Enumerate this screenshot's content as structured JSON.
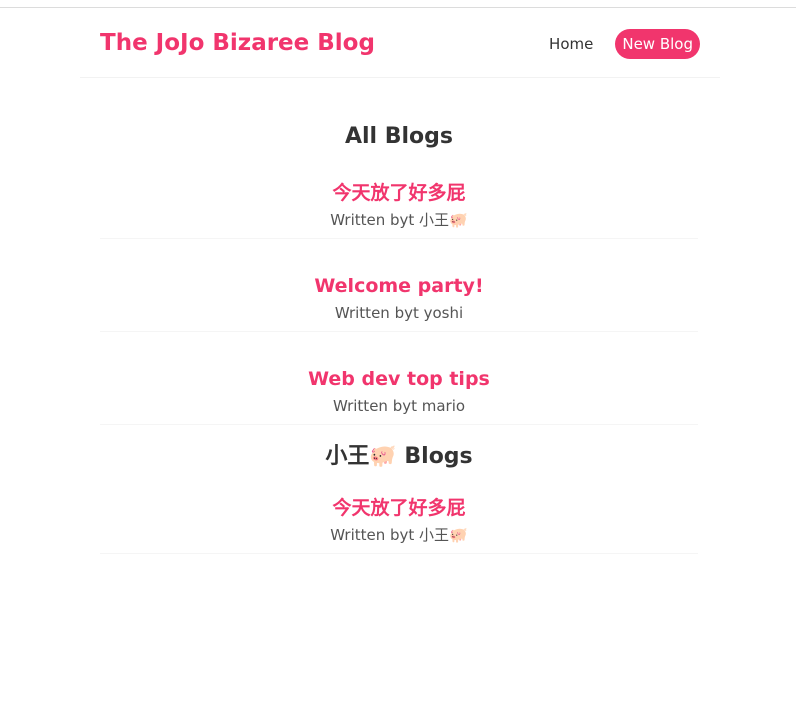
{
  "navbar": {
    "brand": "The JoJo Bizaree Blog",
    "links": [
      {
        "label": "Home"
      },
      {
        "label": "New Blog"
      }
    ],
    "accent_color": "#f1356d"
  },
  "sections": [
    {
      "title": "All Blogs",
      "blogs": [
        {
          "title": "今天放了好多屁",
          "author_line": "Written byt 小王🐖"
        },
        {
          "title": "Welcome party!",
          "author_line": "Written byt yoshi"
        },
        {
          "title": "Web dev top tips",
          "author_line": "Written byt mario"
        }
      ]
    },
    {
      "title": "小王🐖 Blogs",
      "blogs": [
        {
          "title": "今天放了好多屁",
          "author_line": "Written byt 小王🐖"
        }
      ]
    }
  ]
}
